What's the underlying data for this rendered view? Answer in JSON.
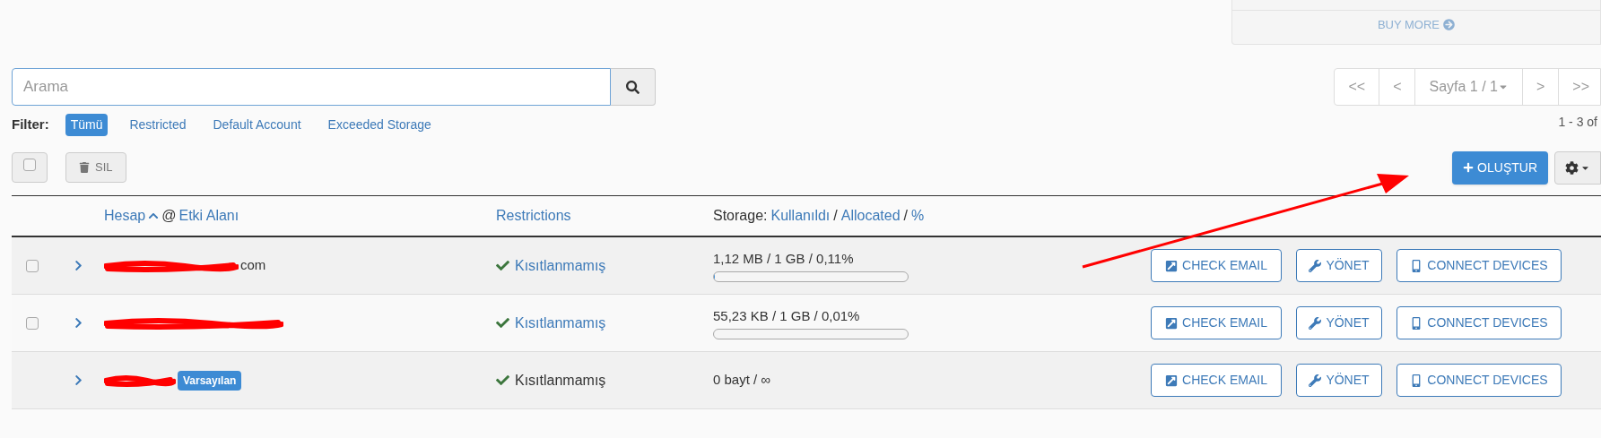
{
  "buy_more": {
    "label": "BUY MORE"
  },
  "search": {
    "placeholder": "Arama"
  },
  "pagination": {
    "first": "<<",
    "prev": "<",
    "page": "Sayfa 1 / 1",
    "next": ">",
    "last": ">>",
    "range": "1 - 3 of"
  },
  "filter": {
    "label": "Filter:",
    "options": [
      {
        "label": "Tümü",
        "selected": true
      },
      {
        "label": "Restricted",
        "selected": false
      },
      {
        "label": "Default Account",
        "selected": false
      },
      {
        "label": "Exceeded Storage",
        "selected": false
      }
    ]
  },
  "toolbar": {
    "select_all_checked": false,
    "delete": "SIL",
    "create": "OLUŞTUR"
  },
  "table": {
    "columns": {
      "account": "Hesap",
      "at": "@",
      "domain": "Etki Alanı",
      "restrictions": "Restrictions",
      "storage": "Storage:",
      "used": "Kullanıldı",
      "allocated": "Allocated",
      "percent": "%",
      "separators": [
        "/",
        "/"
      ]
    },
    "rows": [
      {
        "checkbox": true,
        "checked": false,
        "account_visible": "com",
        "redacted": true,
        "badge": null,
        "restriction": "Kısıtlanmamış",
        "restriction_link": true,
        "storage": "1,12 MB / 1 GB / 0,11%",
        "level": 0.0011,
        "actions": [
          "CHECK EMAIL",
          "YÖNET",
          "CONNECT DEVICES"
        ]
      },
      {
        "checkbox": true,
        "checked": false,
        "account_visible": null,
        "redacted": true,
        "badge": null,
        "restriction": "Kısıtlanmamış",
        "restriction_link": true,
        "storage": "55,23 KB / 1 GB / 0,01%",
        "level": 0.0001,
        "actions": [
          "CHECK EMAIL",
          "YÖNET",
          "CONNECT DEVICES"
        ]
      },
      {
        "checkbox": false,
        "account_visible": null,
        "redacted": true,
        "badge": "Varsayılan",
        "restriction": "Kısıtlanmamış",
        "restriction_link": false,
        "storage": "0 bayt / ∞",
        "level": null,
        "actions": [
          "CHECK EMAIL",
          "YÖNET",
          "CONNECT DEVICES"
        ]
      }
    ]
  },
  "annotation": {
    "kind": "arrow"
  }
}
